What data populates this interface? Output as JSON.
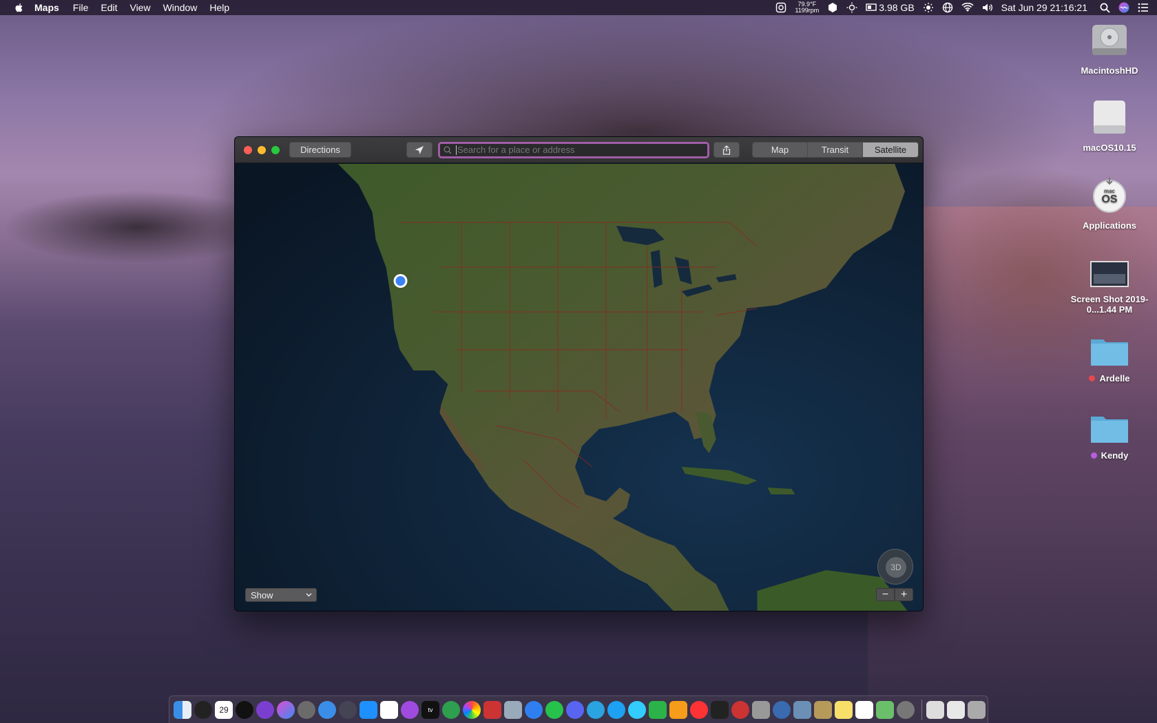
{
  "menubar": {
    "app_name": "Maps",
    "menus": [
      "File",
      "Edit",
      "View",
      "Window",
      "Help"
    ],
    "status": {
      "temp": "79.9°F",
      "fan": "1199rpm",
      "memory": "3.98 GB",
      "clock": "Sat Jun 29  21:16:21"
    }
  },
  "desktop_icons": [
    {
      "label": "MacintoshHD",
      "tag_color": ""
    },
    {
      "label": "macOS10.15",
      "tag_color": ""
    },
    {
      "label": "Applications",
      "tag_color": "",
      "badge": "mac OS"
    },
    {
      "label": "Screen Shot 2019-0...1.44 PM",
      "tag_color": ""
    },
    {
      "label": "Ardelle",
      "tag_color": "#e5484d"
    },
    {
      "label": "Kendy",
      "tag_color": "#b65ee0"
    }
  ],
  "maps_window": {
    "directions_label": "Directions",
    "search": {
      "placeholder": "Search for a place or address",
      "value": ""
    },
    "view_modes": [
      {
        "label": "Map",
        "active": false
      },
      {
        "label": "Transit",
        "active": false
      },
      {
        "label": "Satellite",
        "active": true
      }
    ],
    "show_select": "Show",
    "compass_label": "3D",
    "zoom_out": "−",
    "zoom_in": "+"
  },
  "colors": {
    "search_focus": "#a15da8",
    "location_dot": "#3b82f6",
    "border_lines": "#8a2a1e",
    "ocean": "#0c1826"
  },
  "dock": {
    "apps": [
      "finder-icon",
      "clock-icon",
      "calendar-icon",
      "activity-icon",
      "safari-icon",
      "siri-icon",
      "launchpad-icon",
      "safari-compass-icon",
      "photos-icon",
      "app-store-icon",
      "music-icon",
      "podcasts-icon",
      "tv-icon",
      "find-my-icon",
      "photos-icon",
      "photo-booth-icon",
      "preview-icon",
      "messenger-icon",
      "whatsapp-icon",
      "discord-icon",
      "telegram-icon",
      "twitter-icon",
      "messages-icon",
      "facetime-icon",
      "home-icon",
      "news-icon",
      "stocks-icon",
      "maps-icon",
      "disk-utility-icon",
      "sequel-icon",
      "preview-icon",
      "notes-icon",
      "reminders-icon",
      "maps-icon",
      "system-preferences-icon",
      "textedit-icon",
      "mail-icon",
      "trash-icon"
    ],
    "calendar_day": "29",
    "appletv_label": "tv"
  }
}
